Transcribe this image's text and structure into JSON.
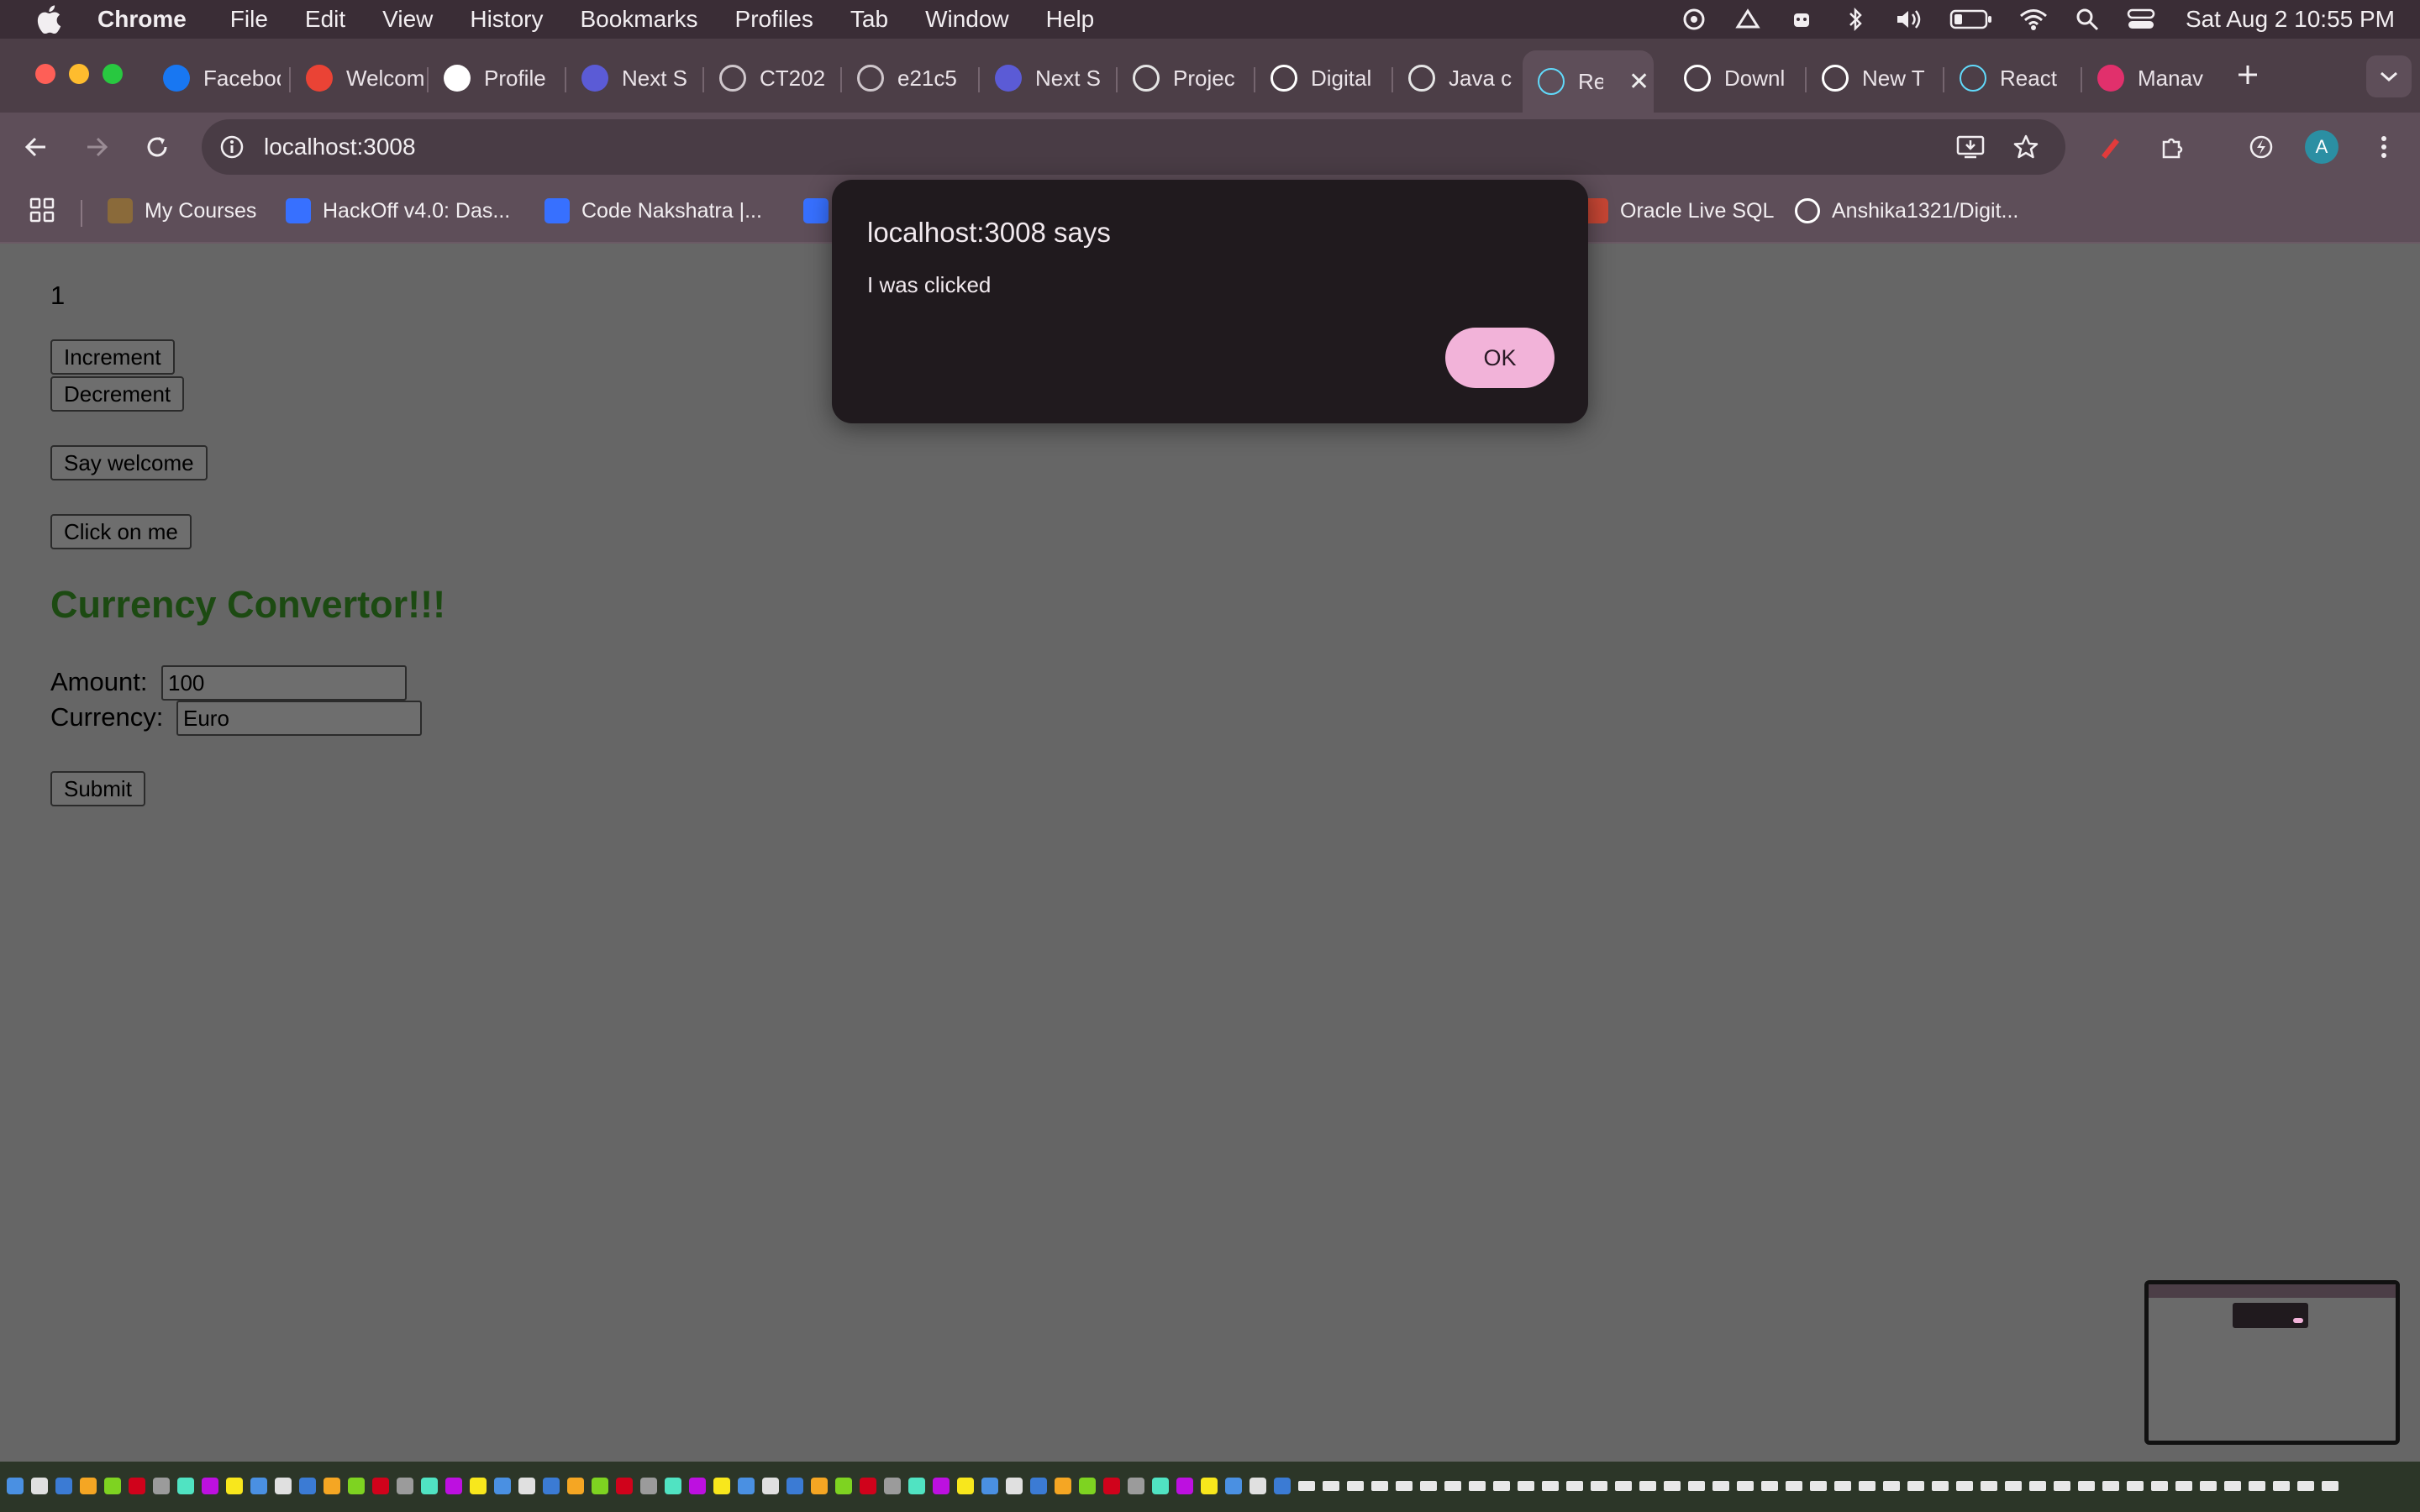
{
  "menubar": {
    "app_name": "Chrome",
    "items": [
      "File",
      "Edit",
      "View",
      "History",
      "Bookmarks",
      "Profiles",
      "Tab",
      "Window",
      "Help"
    ],
    "clock": "Sat Aug 2  10:55 PM"
  },
  "tabs": [
    {
      "title": "Facebook",
      "icon": "facebook-icon",
      "color": "#1877f2"
    },
    {
      "title": "Welcome",
      "icon": "gmail-icon",
      "color": "#ea4335"
    },
    {
      "title": "Profile",
      "icon": "tcs-icon",
      "color": "#ffffff"
    },
    {
      "title": "Next S",
      "icon": "ncp-icon",
      "color": "#5b5bd6"
    },
    {
      "title": "CT202",
      "icon": "globe-icon",
      "color": "#cfc7cc"
    },
    {
      "title": "e21c5",
      "icon": "globe-icon",
      "color": "#cfc7cc"
    },
    {
      "title": "Next S",
      "icon": "ncp-icon",
      "color": "#5b5bd6"
    },
    {
      "title": "Projec",
      "icon": "openai-icon",
      "color": "#e5e5e5"
    },
    {
      "title": "Digital",
      "icon": "github-icon",
      "color": "#ffffff"
    },
    {
      "title": "Java c",
      "icon": "openai-icon",
      "color": "#e5e5e5"
    },
    {
      "title": "Re",
      "icon": "react-icon",
      "color": "#61dafb",
      "active": true
    },
    {
      "title": "Downl",
      "icon": "download-icon",
      "color": "#ffffff"
    },
    {
      "title": "New T",
      "icon": "chrome-icon",
      "color": "#ffffff"
    },
    {
      "title": "React",
      "icon": "react-icon",
      "color": "#61dafb"
    },
    {
      "title": "Manav",
      "icon": "instagram-icon",
      "color": "#e1306c"
    }
  ],
  "omnibox": {
    "url": "localhost:3008"
  },
  "profile": {
    "initial": "A"
  },
  "bookmarks": [
    {
      "label": "My Courses",
      "icon": "courses-icon",
      "color": "#8a6a3a"
    },
    {
      "label": "HackOff v4.0: Das...",
      "icon": "devfolio-icon",
      "color": "#3770ff"
    },
    {
      "label": "Code Nakshatra |...",
      "icon": "devfolio-icon",
      "color": "#3770ff"
    },
    {
      "label": "",
      "icon": "devfolio-icon",
      "color": "#3770ff"
    },
    {
      "label": "Oracle Live SQL",
      "icon": "oracle-icon",
      "color": "#c74634"
    },
    {
      "label": "Anshika1321/Digit...",
      "icon": "github-icon",
      "color": "#ffffff"
    }
  ],
  "page": {
    "counter": "1",
    "increment": "Increment",
    "decrement": "Decrement",
    "say_welcome": "Say welcome",
    "click_me": "Click on me",
    "heading": "Currency Convertor!!!",
    "heading_color": "#1c4a12",
    "amount_label": "Amount:",
    "amount_value": "100",
    "currency_label": "Currency:",
    "currency_value": "Euro",
    "submit": "Submit"
  },
  "dialog": {
    "title": "localhost:3008 says",
    "message": "I was clicked",
    "ok": "OK",
    "ok_color": "#f2b3d9"
  }
}
